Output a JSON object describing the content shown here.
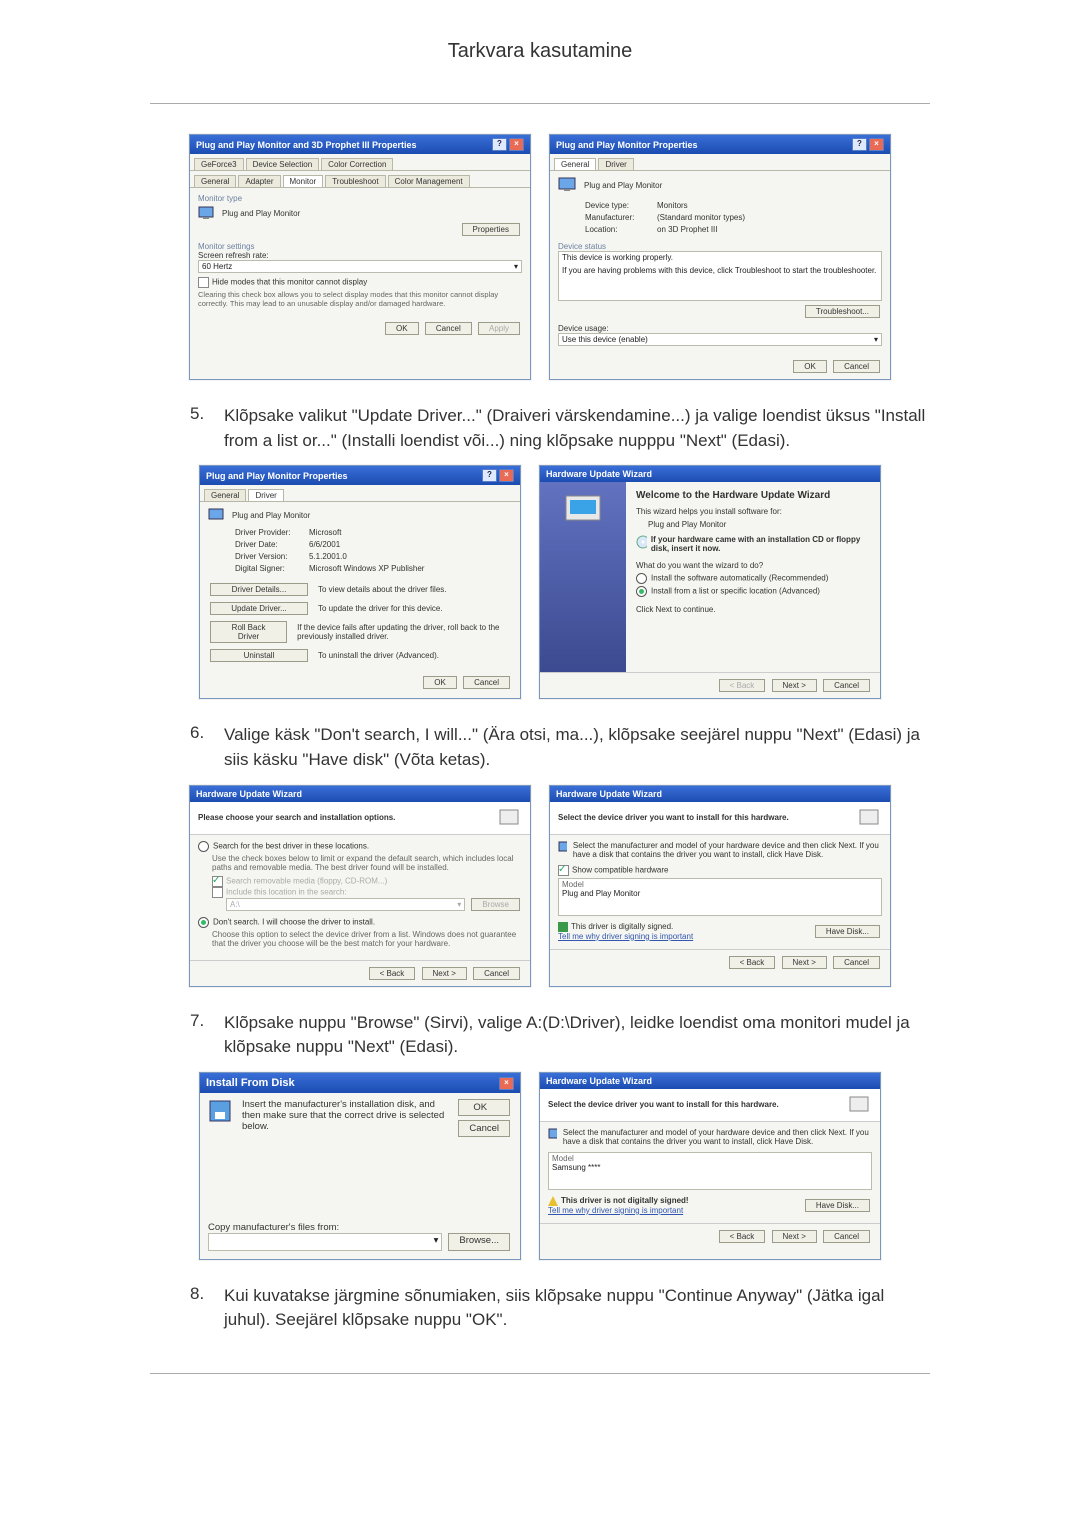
{
  "page_title": "Tarkvara kasutamine",
  "steps": {
    "5": {
      "num": "5.",
      "text": "Klõpsake valikut \"Update Driver...\" (Draiveri värskendamine...) ja valige loendist üksus \"Install from a list or...\" (Installi loendist või...) ning klõpsake nupppu \"Next\" (Edasi)."
    },
    "6": {
      "num": "6.",
      "text": "Valige käsk \"Don't search, I will...\" (Ära otsi, ma...), klõpsake seejärel nuppu \"Next\" (Edasi) ja siis käsku \"Have disk\" (Võta ketas)."
    },
    "7": {
      "num": "7.",
      "text": "Klõpsake nuppu \"Browse\" (Sirvi), valige A:(D:\\Driver), leidke loendist oma monitori mudel ja klõpsake nuppu \"Next\" (Edasi)."
    },
    "8": {
      "num": "8.",
      "text": "Kui kuvatakse järgmine sõnumiaken, siis klõpsake nuppu \"Continue Anyway\" (Jätka igal juhul). Seejärel klõpsake nuppu \"OK\"."
    }
  },
  "btns": {
    "ok": "OK",
    "cancel": "Cancel",
    "apply": "Apply",
    "back": "< Back",
    "next": "Next >",
    "browse": "Browse...",
    "have_disk": "Have Disk..."
  },
  "dlg1_left": {
    "title": "Plug and Play Monitor and 3D Prophet III Properties",
    "tabs_row1": [
      "GeForce3",
      "Device Selection",
      "Color Correction"
    ],
    "tabs_row2": [
      "General",
      "Adapter",
      "Monitor",
      "Troubleshoot",
      "Color Management"
    ],
    "sec1": "Monitor type",
    "mon_name": "Plug and Play Monitor",
    "properties": "Properties",
    "sec2": "Monitor settings",
    "refresh_lbl": "Screen refresh rate:",
    "refresh_val": "60 Hertz",
    "hide": "Hide modes that this monitor cannot display",
    "hide_desc": "Clearing this check box allows you to select display modes that this monitor cannot display correctly. This may lead to an unusable display and/or damaged hardware."
  },
  "dlg1_right": {
    "title": "Plug and Play Monitor Properties",
    "tabs": [
      "General",
      "Driver"
    ],
    "name": "Plug and Play Monitor",
    "type_lbl": "Device type:",
    "type_val": "Monitors",
    "manu_lbl": "Manufacturer:",
    "manu_val": "(Standard monitor types)",
    "loc_lbl": "Location:",
    "loc_val": "on 3D Prophet III",
    "status_lbl": "Device status",
    "status1": "This device is working properly.",
    "status2": "If you are having problems with this device, click Troubleshoot to start the troubleshooter.",
    "troubleshoot": "Troubleshoot...",
    "usage_lbl": "Device usage:",
    "usage_val": "Use this device (enable)"
  },
  "dlg2_left": {
    "title": "Plug and Play Monitor Properties",
    "tabs": [
      "General",
      "Driver"
    ],
    "name": "Plug and Play Monitor",
    "prov_l": "Driver Provider:",
    "prov_v": "Microsoft",
    "date_l": "Driver Date:",
    "date_v": "6/6/2001",
    "ver_l": "Driver Version:",
    "ver_v": "5.1.2001.0",
    "sign_l": "Digital Signer:",
    "sign_v": "Microsoft Windows XP Publisher",
    "b1": "Driver Details...",
    "b1d": "To view details about the driver files.",
    "b2": "Update Driver...",
    "b2d": "To update the driver for this device.",
    "b3": "Roll Back Driver",
    "b3d": "If the device fails after updating the driver, roll back to the previously installed driver.",
    "b4": "Uninstall",
    "b4d": "To uninstall the driver (Advanced)."
  },
  "dlg2_right": {
    "title": "Hardware Update Wizard",
    "h": "Welcome to the Hardware Update Wizard",
    "p1": "This wizard helps you install software for:",
    "p2": "Plug and Play Monitor",
    "cd": "If your hardware came with an installation CD or floppy disk, insert it now.",
    "q": "What do you want the wizard to do?",
    "o1": "Install the software automatically (Recommended)",
    "o2": "Install from a list or specific location (Advanced)",
    "cont": "Click Next to continue."
  },
  "dlg3_left": {
    "title": "Hardware Update Wizard",
    "h": "Please choose your search and installation options.",
    "o1": "Search for the best driver in these locations.",
    "o1d": "Use the check boxes below to limit or expand the default search, which includes local paths and removable media. The best driver found will be installed.",
    "c1": "Search removable media (floppy, CD-ROM...)",
    "c2": "Include this location in the search:",
    "path": "A:\\",
    "browse": "Browse",
    "o2": "Don't search. I will choose the driver to install.",
    "o2d": "Choose this option to select the device driver from a list. Windows does not guarantee that the driver you choose will be the best match for your hardware."
  },
  "dlg3_right": {
    "title": "Hardware Update Wizard",
    "h": "Select the device driver you want to install for this hardware.",
    "p": "Select the manufacturer and model of your hardware device and then click Next. If you have a disk that contains the driver you want to install, click Have Disk.",
    "compat": "Show compatible hardware",
    "model_l": "Model",
    "model_v": "Plug and Play Monitor",
    "signed": "This driver is digitally signed.",
    "tell": "Tell me why driver signing is important"
  },
  "dlg4_left": {
    "title": "Install From Disk",
    "p": "Insert the manufacturer's installation disk, and then make sure that the correct drive is selected below.",
    "copy": "Copy manufacturer's files from:",
    "path": ""
  },
  "dlg4_right": {
    "title": "Hardware Update Wizard",
    "h": "Select the device driver you want to install for this hardware.",
    "p": "Select the manufacturer and model of your hardware device and then click Next. If you have a disk that contains the driver you want to install, click Have Disk.",
    "model_l": "Model",
    "model_v": "Samsung ****",
    "nsigned": "This driver is not digitally signed!",
    "tell": "Tell me why driver signing is important"
  }
}
